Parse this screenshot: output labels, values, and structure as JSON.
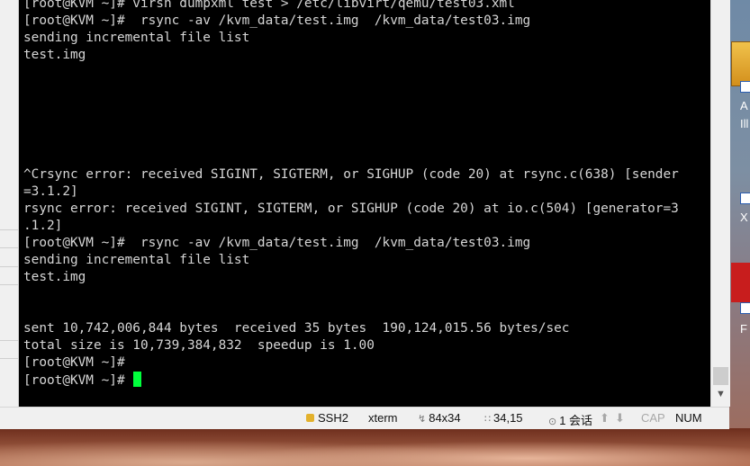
{
  "terminal": {
    "lines": [
      "[root@KVM ~]# virsh dumpxml test > /etc/libvirt/qemu/test03.xml",
      "[root@KVM ~]#  rsync -av /kvm_data/test.img  /kvm_data/test03.img",
      "sending incremental file list",
      "test.img",
      "",
      "",
      "",
      "",
      "",
      "",
      "^Crsync error: received SIGINT, SIGTERM, or SIGHUP (code 20) at rsync.c(638) [sender",
      "=3.1.2]",
      "rsync error: received SIGINT, SIGTERM, or SIGHUP (code 20) at io.c(504) [generator=3",
      ".1.2]",
      "[root@KVM ~]#  rsync -av /kvm_data/test.img  /kvm_data/test03.img",
      "sending incremental file list",
      "test.img",
      "",
      "",
      "sent 10,742,006,844 bytes  received 35 bytes  190,124,015.56 bytes/sec",
      "total size is 10,739,384,832  speedup is 1.00",
      "[root@KVM ~]#",
      "[root@KVM ~]# "
    ]
  },
  "statusbar": {
    "protocol": "SSH2",
    "terminal_type": "xterm",
    "size": "84x34",
    "position": "34,15",
    "sessions": "1 会话",
    "cap": "CAP",
    "num": "NUM"
  },
  "desktop": {
    "icon_texts": [
      "A",
      "Ill",
      "X",
      "F"
    ]
  },
  "colors": {
    "terminal_bg": "#000000",
    "terminal_fg": "#d6d6d6",
    "cursor": "#00ff3c"
  }
}
